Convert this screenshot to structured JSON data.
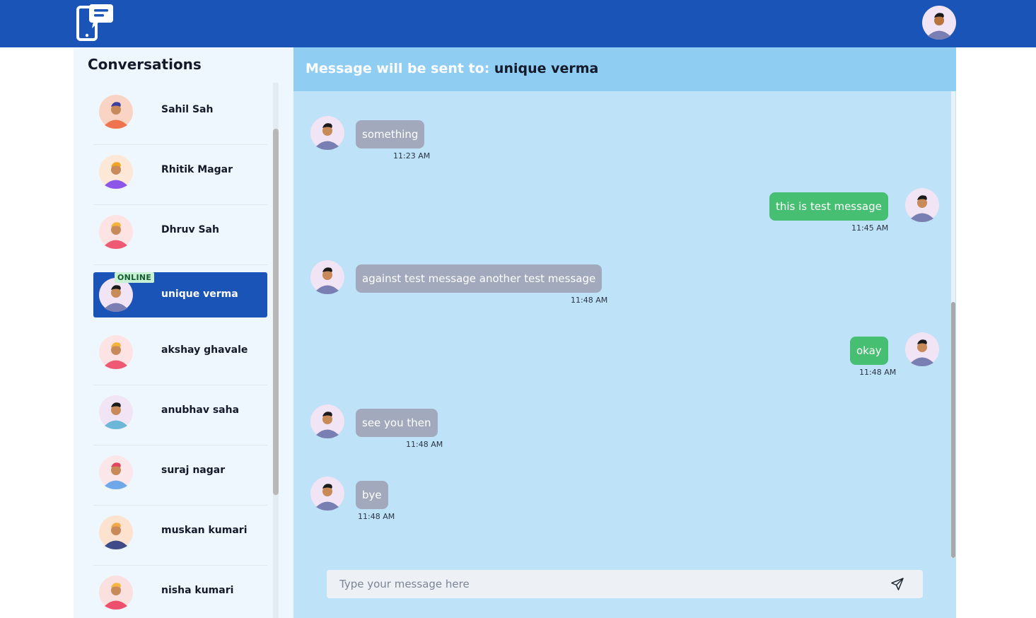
{
  "sidebar": {
    "title": "Conversations",
    "conversations": [
      {
        "name": "Sahil Sah",
        "avatar_bg": "#f9d3c4",
        "body": "#f0734f",
        "hair": "#3b3f9e"
      },
      {
        "name": "Rhitik Magar",
        "avatar_bg": "#fde8d7",
        "body": "#8d55e8",
        "hair": "#f1a526"
      },
      {
        "name": "Dhruv Sah",
        "avatar_bg": "#fde3e3",
        "body": "#ee5a73",
        "hair": "#f3b43c"
      },
      {
        "name": "unique verma",
        "avatar_bg": "#f1e4f4",
        "body": "#7a7fb3",
        "hair": "#1a1a1a",
        "online_label": "ONLINE",
        "selected": true
      },
      {
        "name": "akshay ghavale",
        "avatar_bg": "#fde3e3",
        "body": "#ee5a73",
        "hair": "#f3b43c"
      },
      {
        "name": "anubhav saha",
        "avatar_bg": "#f1e4f4",
        "body": "#6cb6d8",
        "hair": "#1a1a1a"
      },
      {
        "name": "suraj nagar",
        "avatar_bg": "#fbe7ea",
        "body": "#6fa8e8",
        "hair": "#e0475e"
      },
      {
        "name": "muskan kumari",
        "avatar_bg": "#fde2cf",
        "body": "#3f4a88",
        "hair": "#f0a948"
      },
      {
        "name": "nisha kumari",
        "avatar_bg": "#fbe0e0",
        "body": "#ee4f6c",
        "hair": "#f6b740"
      }
    ]
  },
  "chat": {
    "header_prefix": "Message will be sent to:",
    "recipient": "unique verma",
    "messages": [
      {
        "direction": "in",
        "text": "something",
        "time": "11:23 AM"
      },
      {
        "direction": "out",
        "text": "this is test message",
        "time": "11:45 AM"
      },
      {
        "direction": "in",
        "text": "against test message another test message",
        "time": "11:48 AM"
      },
      {
        "direction": "out",
        "text": "okay",
        "time": "11:48 AM"
      },
      {
        "direction": "in",
        "text": "see you then",
        "time": "11:48 AM"
      },
      {
        "direction": "in",
        "text": "bye",
        "time": "11:48 AM"
      }
    ],
    "input_placeholder": "Type your message here"
  },
  "colors": {
    "topbar": "#1a54b7",
    "incoming_bubble": "#a2a9bc",
    "outgoing_bubble": "#46bf72",
    "chat_bg": "#bee2f7",
    "chat_header_bg": "#8fcdf3"
  },
  "icons": {
    "logo": "phone-chat-logo-icon",
    "send": "send-paper-plane-icon"
  }
}
